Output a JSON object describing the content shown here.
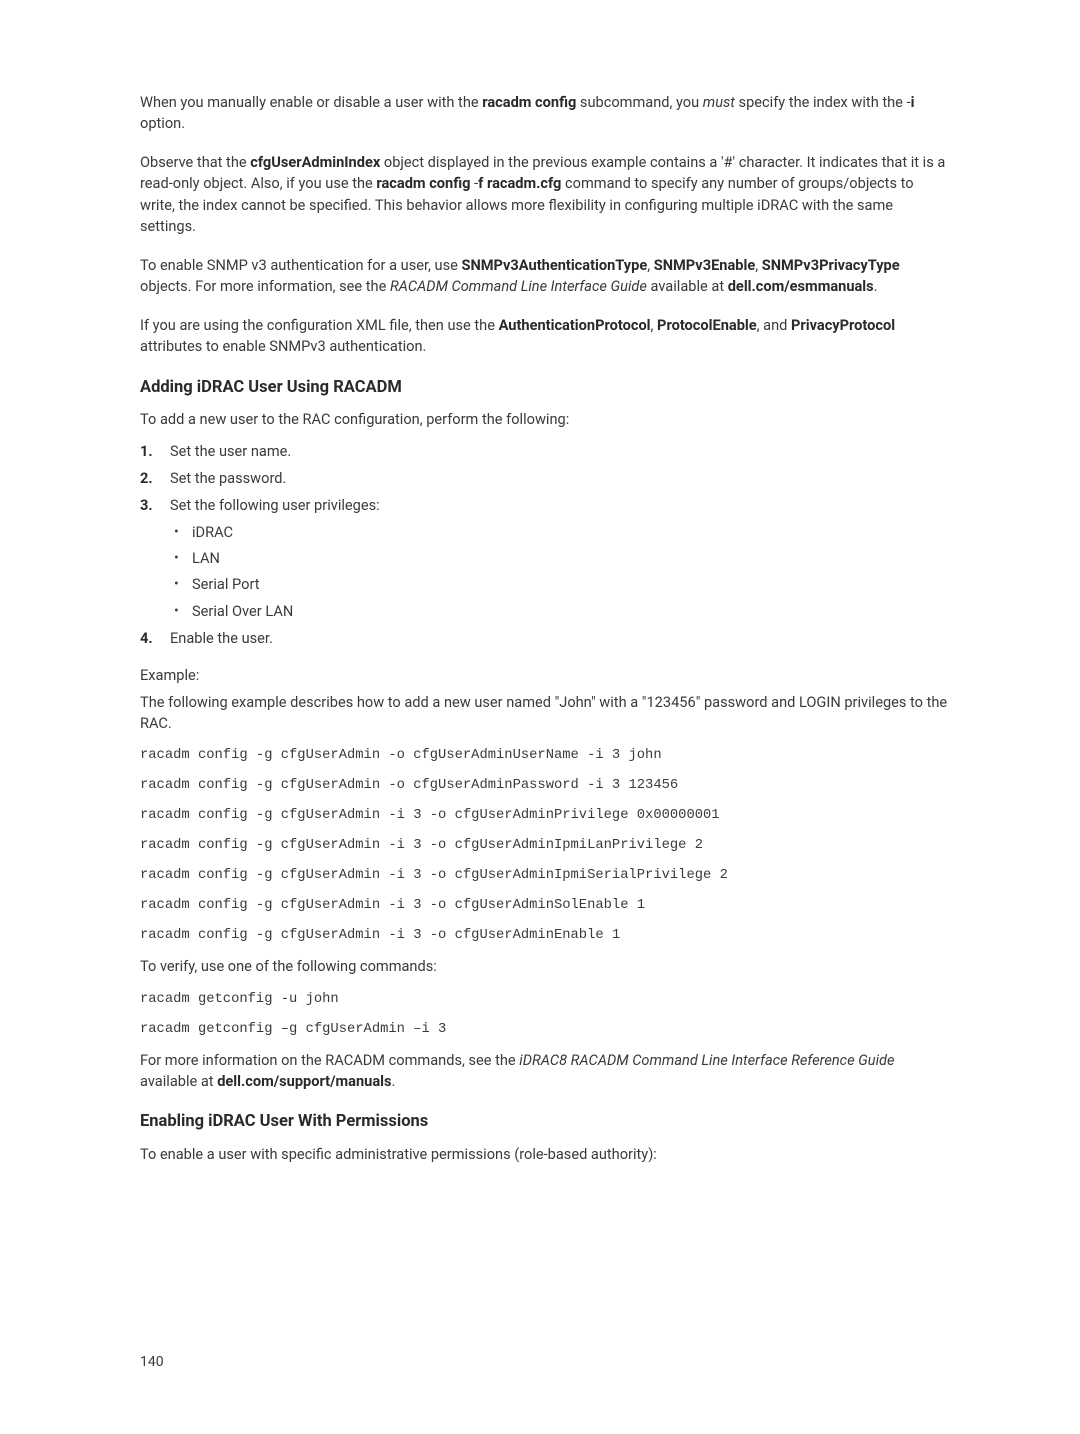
{
  "para1": {
    "a": "When you manually enable or disable a user with the ",
    "b": "racadm config",
    "c": " subcommand, you ",
    "d": "must",
    "e": " specify the index with the -",
    "f": "i",
    "g": " option."
  },
  "para2": {
    "a": "Observe that the ",
    "b": "cfgUserAdminIndex",
    "c": " object displayed in the previous example contains a '#' character. It indicates that it is a read-only object. Also, if you use the ",
    "d": "racadm config",
    "e": " -",
    "f": "f racadm.cfg",
    "g": " command to specify any number of groups/objects to write, the index cannot be specified. This behavior allows more flexibility in configuring multiple iDRAC with the same settings."
  },
  "para3": {
    "a": "To enable SNMP v3 authentication for a user, use ",
    "b": "SNMPv3AuthenticationType",
    "c": ", ",
    "d": "SNMPv3Enable",
    "e": ", ",
    "f": "SNMPv3PrivacyType",
    "g": " objects. For more information, see the ",
    "h": "RACADM Command Line Interface Guide",
    "i": " available at ",
    "j": "dell.com/esmmanuals",
    "k": "."
  },
  "para4": {
    "a": "If you are using the configuration XML file, then use the ",
    "b": "AuthenticationProtocol",
    "c": ", ",
    "d": "ProtocolEnable",
    "e": ", and ",
    "f": "PrivacyProtocol",
    "g": " attributes to enable SNMPv3 authentication."
  },
  "section1": {
    "heading": "Adding iDRAC User Using RACADM",
    "intro": "To add a new user to the RAC configuration, perform the following:",
    "steps": {
      "n1": "1.",
      "s1": "Set the user name.",
      "n2": "2.",
      "s2": "Set the password.",
      "n3": "3.",
      "s3": "Set the following user privileges:",
      "sub": {
        "a": "iDRAC",
        "b": "LAN",
        "c": "Serial Port",
        "d": "Serial Over LAN"
      },
      "n4": "4.",
      "s4": "Enable the user."
    },
    "example_label": "Example:",
    "example_desc": "The following example describes how to add a new user named \"John\" with a \"123456\" password and LOGIN privileges to the RAC.",
    "code": [
      "racadm config -g cfgUserAdmin -o cfgUserAdminUserName -i 3 john",
      "racadm config -g cfgUserAdmin -o cfgUserAdminPassword -i 3 123456",
      "racadm config -g cfgUserAdmin -i 3 -o cfgUserAdminPrivilege 0x00000001",
      "racadm config -g cfgUserAdmin -i 3 -o cfgUserAdminIpmiLanPrivilege 2",
      "racadm config -g cfgUserAdmin -i 3 -o cfgUserAdminIpmiSerialPrivilege 2",
      "racadm config -g cfgUserAdmin -i 3 -o cfgUserAdminSolEnable 1",
      "racadm config -g cfgUserAdmin -i 3 -o cfgUserAdminEnable 1"
    ],
    "verify": "To verify, use one of the following commands:",
    "verify_code": [
      "racadm getconfig -u john",
      "racadm getconfig –g cfgUserAdmin –i 3"
    ],
    "footnote": {
      "a": "For more information on the RACADM commands, see the ",
      "b": "iDRAC8 RACADM Command Line Interface Reference Guide",
      "c": " available at ",
      "d": "dell.com/support/manuals",
      "e": "."
    }
  },
  "section2": {
    "heading": "Enabling iDRAC User With Permissions",
    "intro": "To enable a user with specific administrative permissions (role-based authority):"
  },
  "page_number": "140"
}
